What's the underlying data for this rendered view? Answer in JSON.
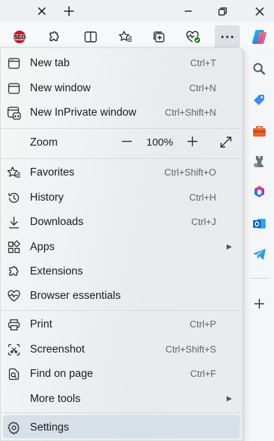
{
  "window": {
    "close_tab_icon": "close-icon",
    "new_tab_icon": "plus-icon",
    "minimize_icon": "minimize-icon",
    "restore_icon": "restore-icon",
    "close_icon": "close-icon"
  },
  "toolbar": {
    "seo_badge": "SEO",
    "tools": [
      "seo-extension-icon",
      "extensions-icon",
      "split-screen-icon",
      "favorites-icon",
      "collections-icon",
      "browser-essentials-icon",
      "more-icon",
      "copilot-icon"
    ]
  },
  "menu": {
    "new_tab": {
      "label": "New tab",
      "shortcut": "Ctrl+T"
    },
    "new_window": {
      "label": "New window",
      "shortcut": "Ctrl+N"
    },
    "new_inprivate": {
      "label": "New InPrivate window",
      "shortcut": "Ctrl+Shift+N"
    },
    "zoom": {
      "label": "Zoom",
      "minus": "—",
      "value": "100%",
      "plus": "+"
    },
    "favorites": {
      "label": "Favorites",
      "shortcut": "Ctrl+Shift+O"
    },
    "history": {
      "label": "History",
      "shortcut": "Ctrl+H"
    },
    "downloads": {
      "label": "Downloads",
      "shortcut": "Ctrl+J"
    },
    "apps": {
      "label": "Apps",
      "arrow": "▶"
    },
    "extensions": {
      "label": "Extensions"
    },
    "browser_essentials": {
      "label": "Browser essentials"
    },
    "print": {
      "label": "Print",
      "shortcut": "Ctrl+P"
    },
    "screenshot": {
      "label": "Screenshot",
      "shortcut": "Ctrl+Shift+S"
    },
    "find_on_page": {
      "label": "Find on page",
      "shortcut": "Ctrl+F"
    },
    "more_tools": {
      "label": "More tools",
      "arrow": "▶"
    },
    "settings": {
      "label": "Settings"
    }
  },
  "sidebar": {
    "items": [
      "search-icon",
      "shopping-tag-icon",
      "tools-icon",
      "games-icon",
      "microsoft365-icon",
      "outlook-icon",
      "telegram-icon",
      "add-icon"
    ]
  },
  "colors": {
    "accent": "#0f6cbd",
    "selected_bg": "#d7dfe8"
  }
}
